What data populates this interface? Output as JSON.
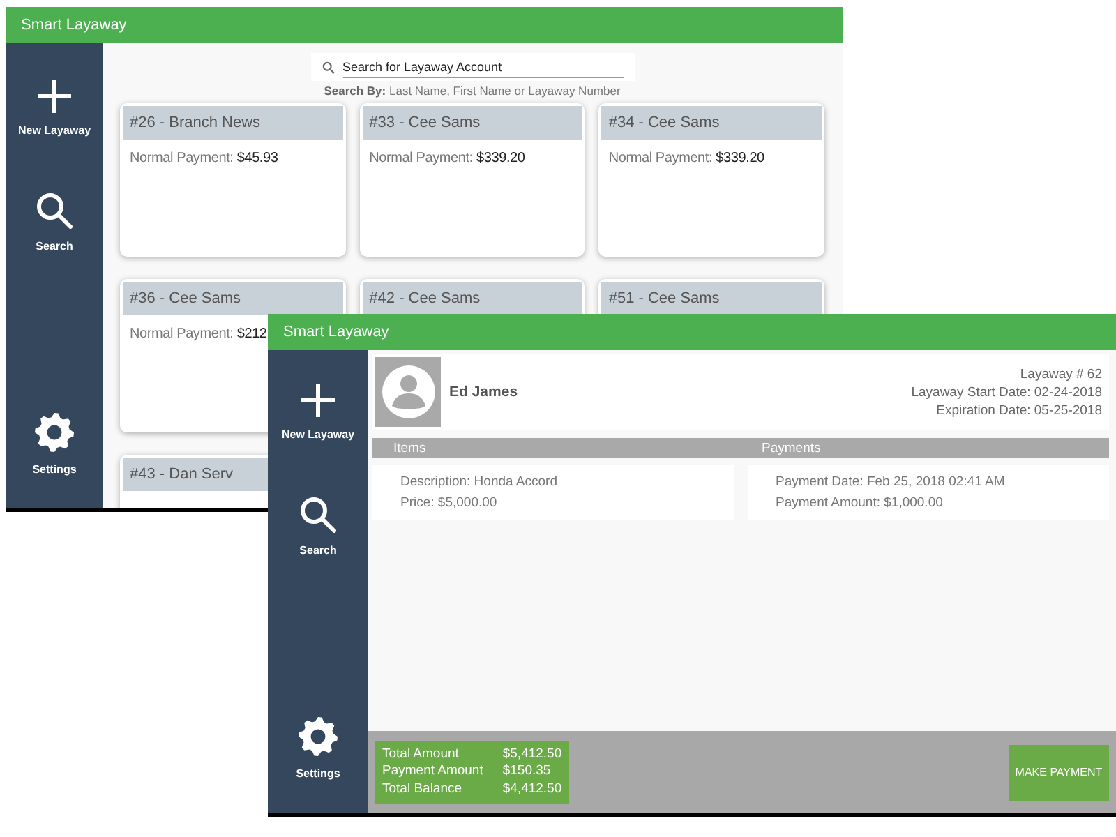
{
  "back_window": {
    "title": "Smart Layaway",
    "sidebar": [
      {
        "kind": "add",
        "label": "New Layaway"
      },
      {
        "kind": "search",
        "label": "Search"
      },
      {
        "kind": "settings",
        "label": "Settings"
      }
    ],
    "search": {
      "placeholder": "Search for Layaway Account"
    },
    "search_hint": "**Search By:** Last Name, First Name or Layaway Number",
    "cards": [
      {
        "title": "#26 - Branch News",
        "payment_label": "Normal Payment:",
        "payment": "$45.93"
      },
      {
        "title": "#33 - Cee Sams",
        "payment_label": "Normal Payment:",
        "payment": "$339.20"
      },
      {
        "title": "#34 - Cee Sams",
        "payment_label": "Normal Payment:",
        "payment": "$339.20"
      },
      {
        "title": "#36 - Cee Sams",
        "payment_label": "Normal Payment:",
        "payment": "$212"
      },
      {
        "title": "#42 - Cee Sams"
      },
      {
        "title": "#51 - Cee Sams"
      },
      {
        "title": "#43 - Dan Serv"
      }
    ]
  },
  "front_window": {
    "title": "Smart Layaway",
    "sidebar": [
      {
        "kind": "add",
        "label": "New Layaway"
      },
      {
        "kind": "search",
        "label": "Search"
      },
      {
        "kind": "settings",
        "label": "Settings"
      }
    ],
    "account": {
      "name": "Ed James",
      "number": "Layaway # 62",
      "start_date": "Layaway Start Date: 02-24-2018",
      "expiration_date": "Expiration Date: 05-25-2018"
    },
    "columns": [
      "Items",
      "Payments"
    ],
    "item": {
      "description": "Description: Honda Accord",
      "price": "Price:  $5,000.00"
    },
    "payment": {
      "date": "Payment Date: Feb 25, 2018 02:41 AM",
      "amount": "Payment Amount: $1,000.00"
    },
    "totals": [
      {
        "label": "Total Amount",
        "value": "$5,412.50"
      },
      {
        "label": "Payment Amount",
        "value": "$150.35"
      },
      {
        "label": "Total Balance",
        "value": "$4,412.50"
      }
    ],
    "button": "MAKE PAYMENT"
  }
}
